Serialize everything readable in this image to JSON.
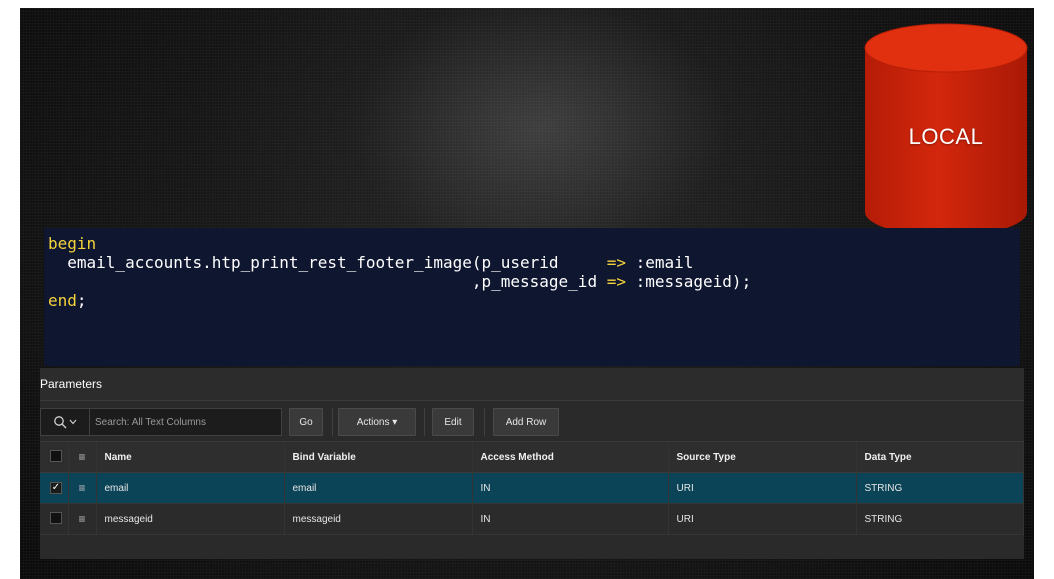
{
  "cylinder": {
    "label": "LOCAL",
    "color": "#c8200a"
  },
  "code": {
    "line1_kw": "begin",
    "line2": "  email_accounts.htp_print_rest_footer_image(p_userid     ",
    "line2_op": "=>",
    "line2_tail": " :email",
    "line3": "                                            ,p_message_id ",
    "line3_op": "=>",
    "line3_tail": " :messageid);",
    "line4_kw": "end",
    "line4_tail": ";"
  },
  "panel": {
    "title": "Parameters",
    "search": {
      "placeholder": "Search: All Text Columns",
      "icon": "search-icon"
    },
    "buttons": {
      "go": "Go",
      "actions": "Actions ▾",
      "edit": "Edit",
      "add_row": "Add Row"
    }
  },
  "table": {
    "columns": [
      "Name",
      "Bind Variable",
      "Access Method",
      "Source Type",
      "Data Type"
    ],
    "rows": [
      {
        "selected": true,
        "name": "email",
        "bind": "email",
        "access": "IN",
        "source": "URI",
        "dtype": "STRING"
      },
      {
        "selected": false,
        "name": "messageid",
        "bind": "messageid",
        "access": "IN",
        "source": "URI",
        "dtype": "STRING"
      }
    ]
  }
}
